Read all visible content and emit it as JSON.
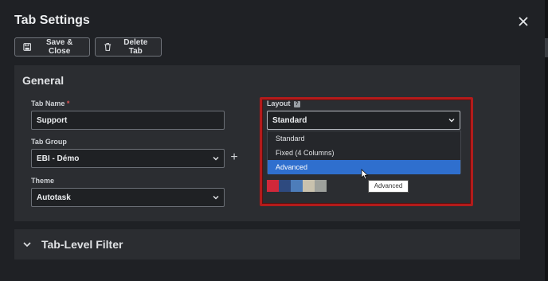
{
  "modal": {
    "title": "Tab Settings"
  },
  "toolbar": {
    "save_label": "Save & Close",
    "delete_label": "Delete Tab"
  },
  "general": {
    "title": "General",
    "tab_name": {
      "label": "Tab Name",
      "required_mark": "*",
      "value": "Support"
    },
    "tab_group": {
      "label": "Tab Group",
      "value": "EBI - Démo"
    },
    "theme": {
      "label": "Theme",
      "value": "Autotask"
    },
    "layout": {
      "label": "Layout",
      "help_badge": "?",
      "value": "Standard",
      "options": [
        "Standard",
        "Fixed (4 Columns)",
        "Advanced"
      ],
      "hovered_option": "Advanced"
    },
    "swatch_colors": [
      "#d0283a",
      "#2e4a7f",
      "#4d7dba",
      "#c9c2ae",
      "#9ea19c"
    ]
  },
  "tooltip": {
    "text": "Advanced"
  },
  "filter_section": {
    "title": "Tab-Level Filter"
  },
  "colors": {
    "background": "#1f2125",
    "panel": "#2b2d31",
    "accent_selected": "#2f6fce",
    "highlight_frame": "#b31b1b"
  }
}
